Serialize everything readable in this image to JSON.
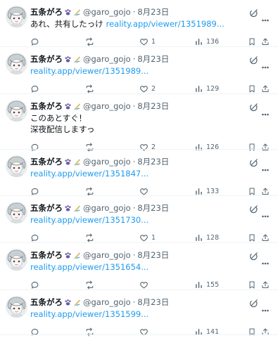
{
  "tweets": [
    {
      "name": "五条がろ",
      "handle": "@garo_gojo",
      "separator": "·",
      "date": "8月23日",
      "lines": [
        "あれ、共有したっけ"
      ],
      "link": "reality.app/viewer/1351989...",
      "replies": "",
      "retweets": "",
      "likes": "1",
      "views": "136"
    },
    {
      "name": "五条がろ",
      "handle": "@garo_gojo",
      "separator": "·",
      "date": "8月23日",
      "lines": [],
      "link": "reality.app/viewer/1351989...",
      "replies": "",
      "retweets": "",
      "likes": "2",
      "views": "129"
    },
    {
      "name": "五条がろ",
      "handle": "@garo_gojo",
      "separator": "·",
      "date": "8月23日",
      "lines": [
        "このあとすぐ！",
        "深夜配信しますっ"
      ],
      "link": "",
      "replies": "",
      "retweets": "",
      "likes": "2",
      "views": "126"
    },
    {
      "name": "五条がろ",
      "handle": "@garo_gojo",
      "separator": "·",
      "date": "8月23日",
      "lines": [],
      "link": "reality.app/viewer/1351847...",
      "replies": "",
      "retweets": "",
      "likes": "",
      "views": "133"
    },
    {
      "name": "五条がろ",
      "handle": "@garo_gojo",
      "separator": "·",
      "date": "8月23日",
      "lines": [],
      "link": "reality.app/viewer/1351730...",
      "replies": "",
      "retweets": "",
      "likes": "1",
      "views": "128"
    },
    {
      "name": "五条がろ",
      "handle": "@garo_gojo",
      "separator": "·",
      "date": "8月23日",
      "lines": [],
      "link": "reality.app/viewer/1351654...",
      "replies": "",
      "retweets": "",
      "likes": "",
      "views": "155"
    },
    {
      "name": "五条がろ",
      "handle": "@garo_gojo",
      "separator": "·",
      "date": "8月23日",
      "lines": [],
      "link": "reality.app/viewer/1351599...",
      "replies": "",
      "retweets": "",
      "likes": "",
      "views": "141"
    }
  ],
  "icons": {
    "reply": "reply-icon",
    "retweet": "retweet-icon",
    "like": "heart-icon",
    "views": "views-icon",
    "bookmark": "bookmark-icon",
    "share": "share-icon",
    "grok": "grok-icon",
    "more": "more-icon"
  },
  "colors": {
    "link": "#1d9bf0",
    "secondary": "#536471",
    "divider": "#eff3f4"
  }
}
